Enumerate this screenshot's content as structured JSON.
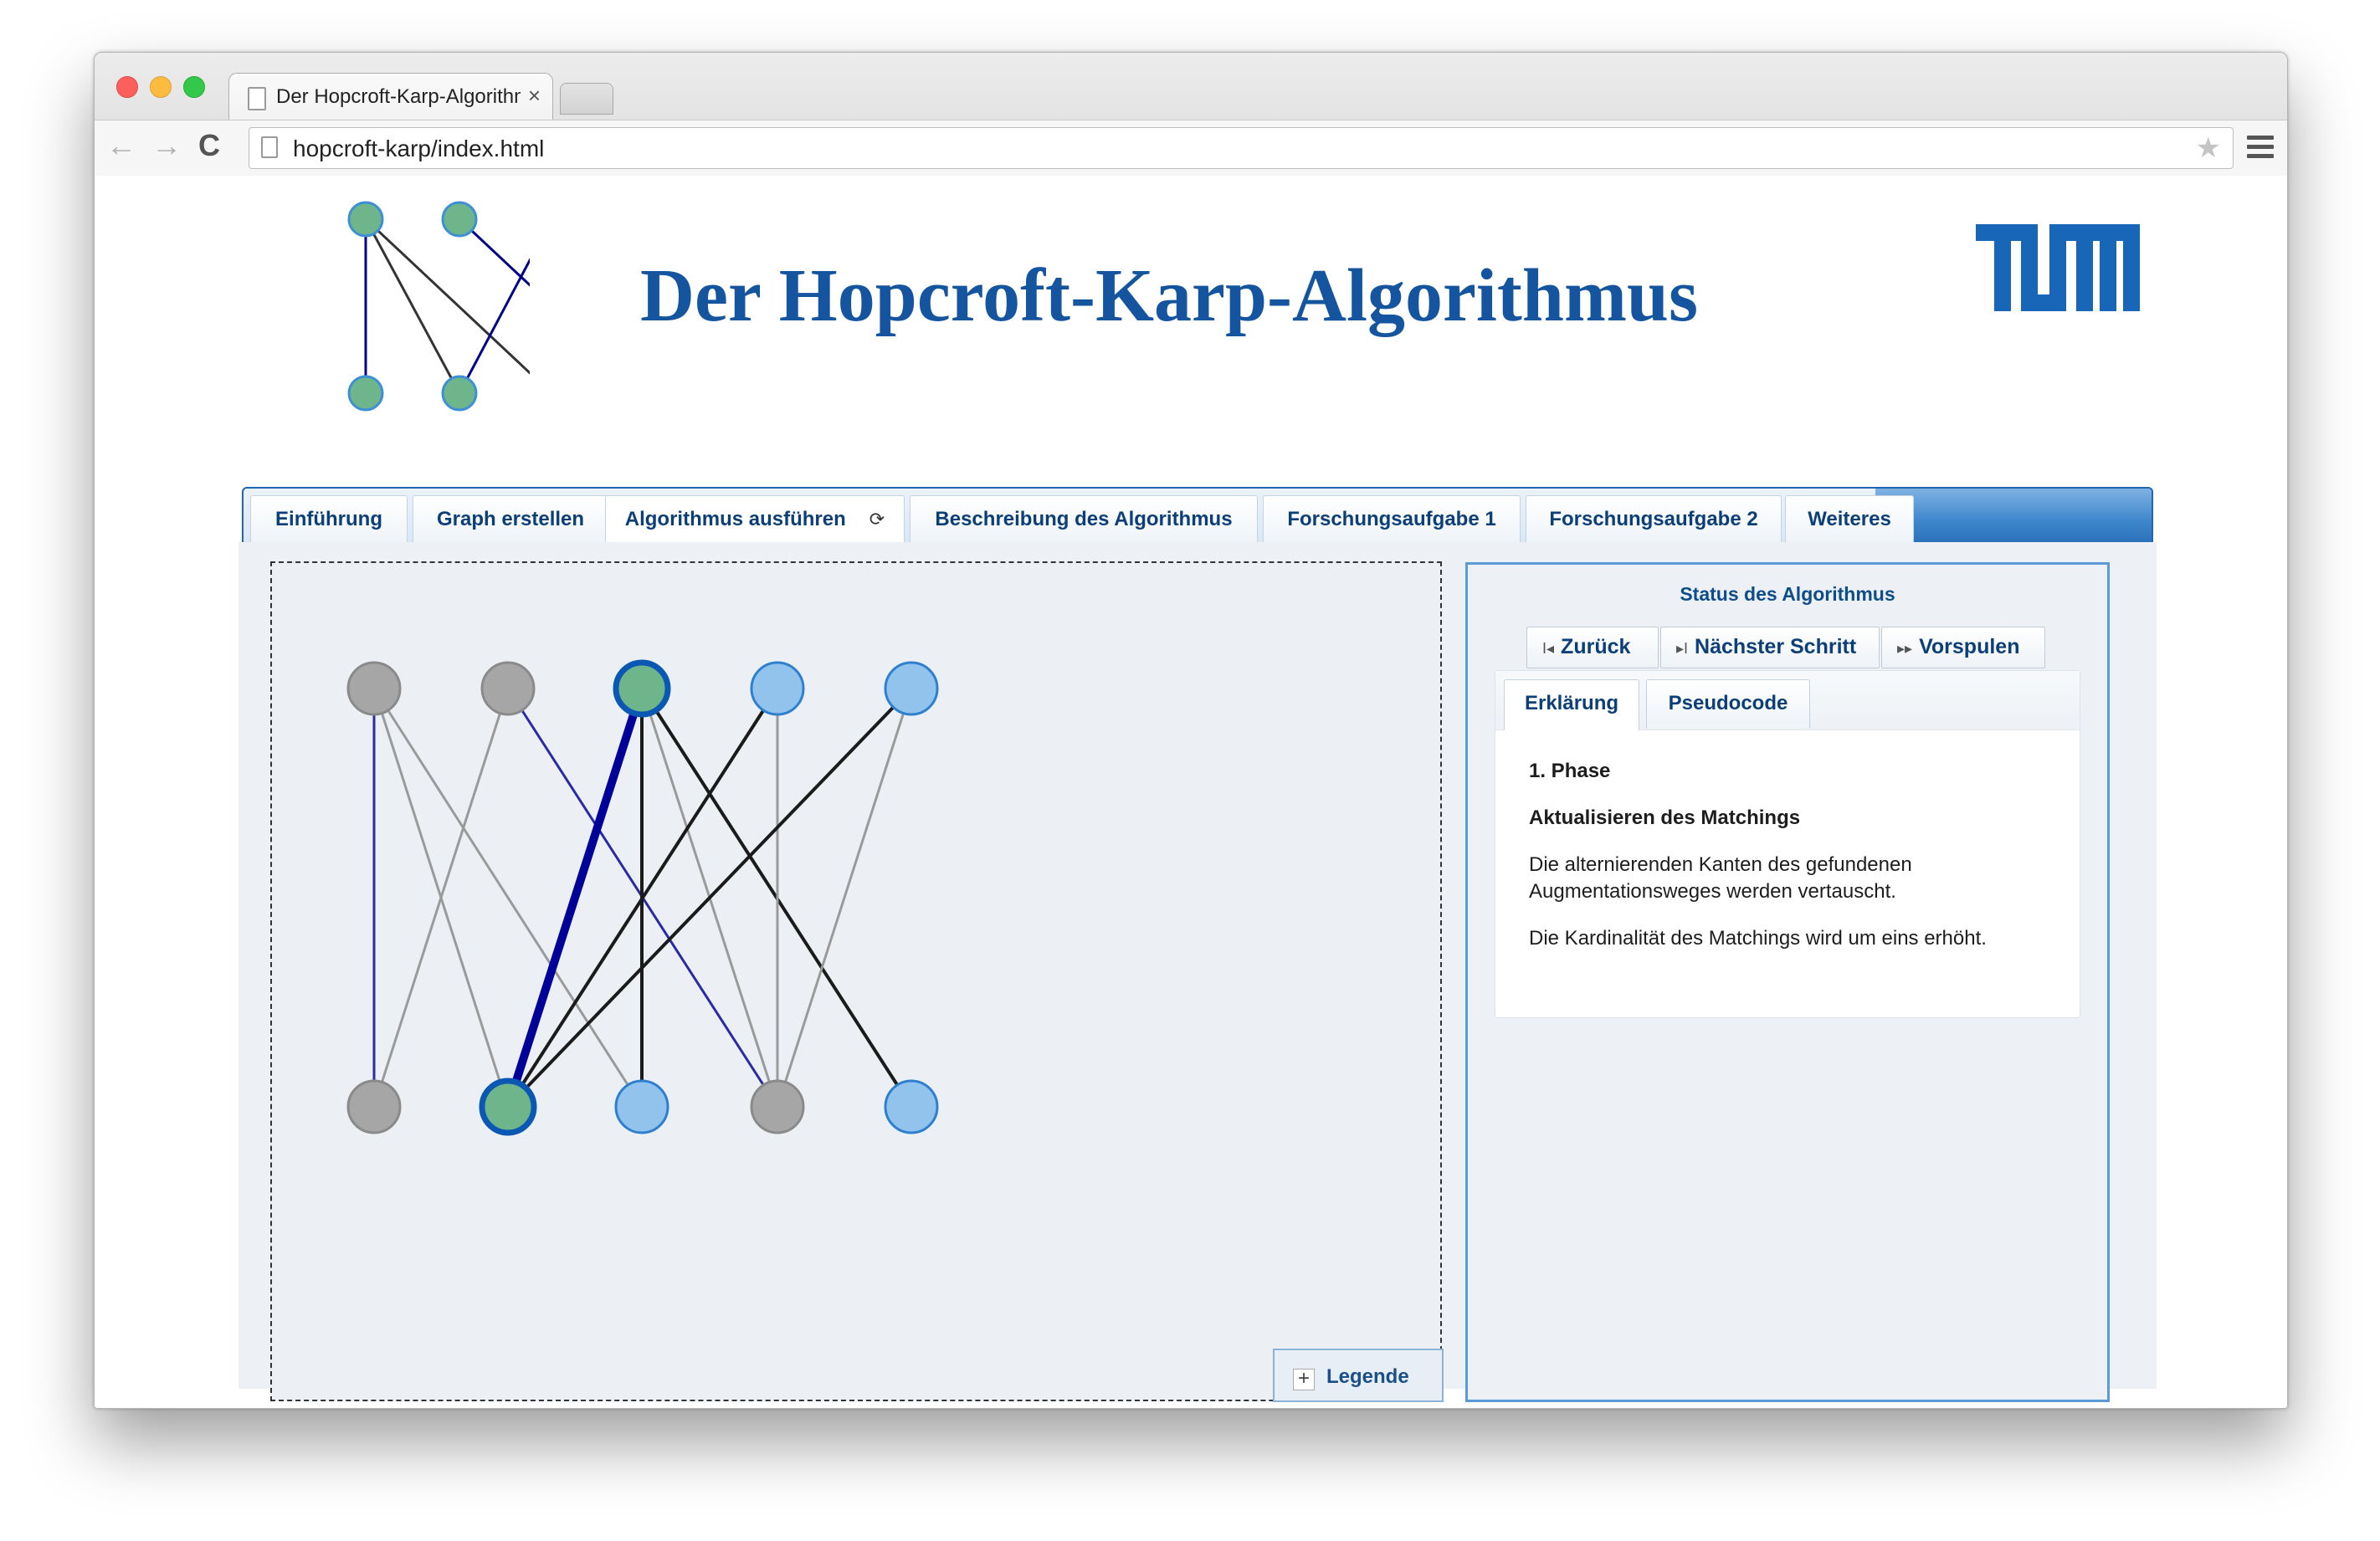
{
  "browser": {
    "tab_title": "Der Hopcroft-Karp-Algorithmus",
    "tab_close": "×",
    "url": "hopcroft-karp/index.html",
    "back": "←",
    "forward": "→",
    "reload": "C",
    "star": "★"
  },
  "header": {
    "title": "Der Hopcroft-Karp-Algorithmus"
  },
  "tabs": [
    {
      "label": "Einführung"
    },
    {
      "label": "Graph erstellen"
    },
    {
      "label": "Algorithmus ausführen",
      "icon": "⟳"
    },
    {
      "label": "Beschreibung des Algorithmus"
    },
    {
      "label": "Forschungsaufgabe 1"
    },
    {
      "label": "Forschungsaufgabe 2"
    },
    {
      "label": "Weiteres"
    }
  ],
  "legend": {
    "label": "Legende",
    "icon": "+"
  },
  "status": {
    "title": "Status des Algorithmus",
    "buttons": {
      "back": "Zurück",
      "back_icon": "I◂",
      "next": "Nächster Schritt",
      "next_icon": "▸I",
      "forward": "Vorspulen",
      "forward_icon": "▸▸"
    },
    "inner_tabs": {
      "explanation": "Erklärung",
      "pseudocode": "Pseudocode"
    },
    "explanation": {
      "phase": "1. Phase",
      "heading": "Aktualisieren des Matchings",
      "text1": "Die alternierenden Kanten des gefundenen Augmentationsweges werden vertauscht.",
      "text2": "Die Kardinalität des Matchings wird um eins erhöht."
    }
  },
  "colors": {
    "accent": "#1555a0",
    "node_gray": "#a6a6a6",
    "node_green": "#6fb58c",
    "node_blue": "#92c3ec",
    "matched_edge": "#000099"
  },
  "graph": {
    "top_nodes": [
      {
        "state": "gray"
      },
      {
        "state": "gray"
      },
      {
        "state": "green-highlight"
      },
      {
        "state": "blue"
      },
      {
        "state": "blue"
      }
    ],
    "bottom_nodes": [
      {
        "state": "gray"
      },
      {
        "state": "green-highlight"
      },
      {
        "state": "blue"
      },
      {
        "state": "gray"
      },
      {
        "state": "blue"
      }
    ],
    "edges": [
      {
        "from": "t0",
        "to": "b0",
        "style": "matched"
      },
      {
        "from": "t0",
        "to": "b1",
        "style": "plain"
      },
      {
        "from": "t0",
        "to": "b2",
        "style": "plain"
      },
      {
        "from": "t1",
        "to": "b0",
        "style": "plain"
      },
      {
        "from": "t1",
        "to": "b3",
        "style": "matched"
      },
      {
        "from": "t2",
        "to": "b1",
        "style": "path-matched"
      },
      {
        "from": "t2",
        "to": "b2",
        "style": "path"
      },
      {
        "from": "t2",
        "to": "b3",
        "style": "plain"
      },
      {
        "from": "t2",
        "to": "b4",
        "style": "path"
      },
      {
        "from": "t3",
        "to": "b1",
        "style": "path"
      },
      {
        "from": "t3",
        "to": "b3",
        "style": "plain"
      },
      {
        "from": "t4",
        "to": "b1",
        "style": "path"
      },
      {
        "from": "t4",
        "to": "b3",
        "style": "plain"
      }
    ]
  }
}
